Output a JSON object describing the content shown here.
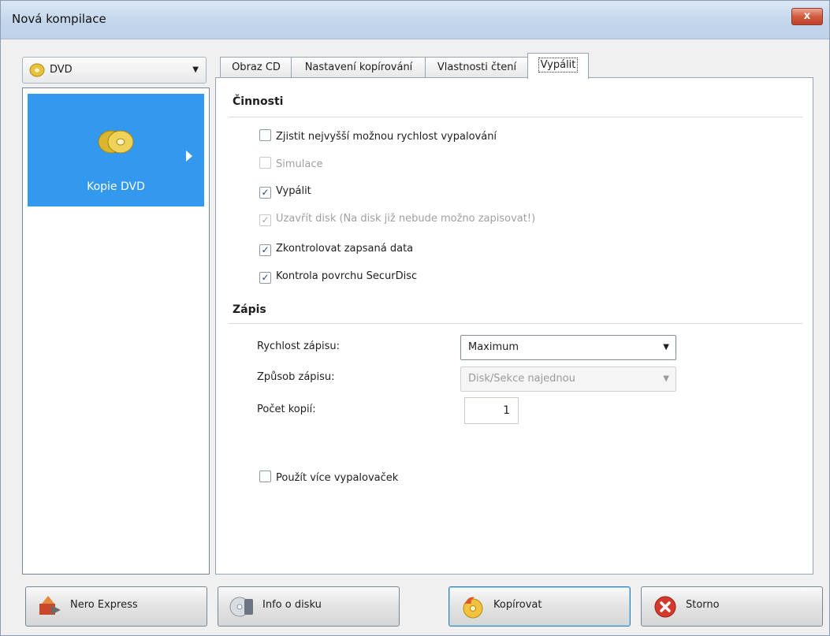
{
  "window": {
    "title": "Nová kompilace",
    "close_label": "x"
  },
  "left": {
    "combo_value": "DVD",
    "category_label": "Kopie DVD"
  },
  "tabs": [
    {
      "label": "Obraz CD"
    },
    {
      "label": "Nastavení kopírování"
    },
    {
      "label": "Vlastnosti čtení"
    },
    {
      "label": "Vypálit",
      "active": true
    }
  ],
  "actions": {
    "section_title": "Činnosti",
    "checkboxes": [
      {
        "label": "Zjistit nejvyšší možnou rychlost vypalování",
        "checked": false,
        "disabled": false
      },
      {
        "label": "Simulace",
        "checked": false,
        "disabled": true
      },
      {
        "label": "Vypálit",
        "checked": true,
        "disabled": false
      },
      {
        "label": "Uzavřít disk (Na disk již nebude možno zapisovat!)",
        "checked": true,
        "disabled": true
      },
      {
        "label": "Zkontrolovat zapsaná data",
        "checked": true,
        "disabled": false
      },
      {
        "label": "Kontrola povrchu SecurDisc",
        "checked": true,
        "disabled": false
      }
    ]
  },
  "writing": {
    "section_title": "Zápis",
    "speed_label": "Rychlost zápisu:",
    "speed_value": "Maximum",
    "method_label": "Způsob zápisu:",
    "method_value": "Disk/Sekce najednou",
    "copies_label": "Počet kopií:",
    "copies_value": "1",
    "multi_label": "Použít více vypalovaček"
  },
  "buttons": {
    "nero_express": "Nero Express",
    "disc_info": "Info o disku",
    "copy": "Kopírovat",
    "cancel": "Storno"
  },
  "colors": {
    "selection": "#3399ee",
    "check": "#21457a"
  }
}
